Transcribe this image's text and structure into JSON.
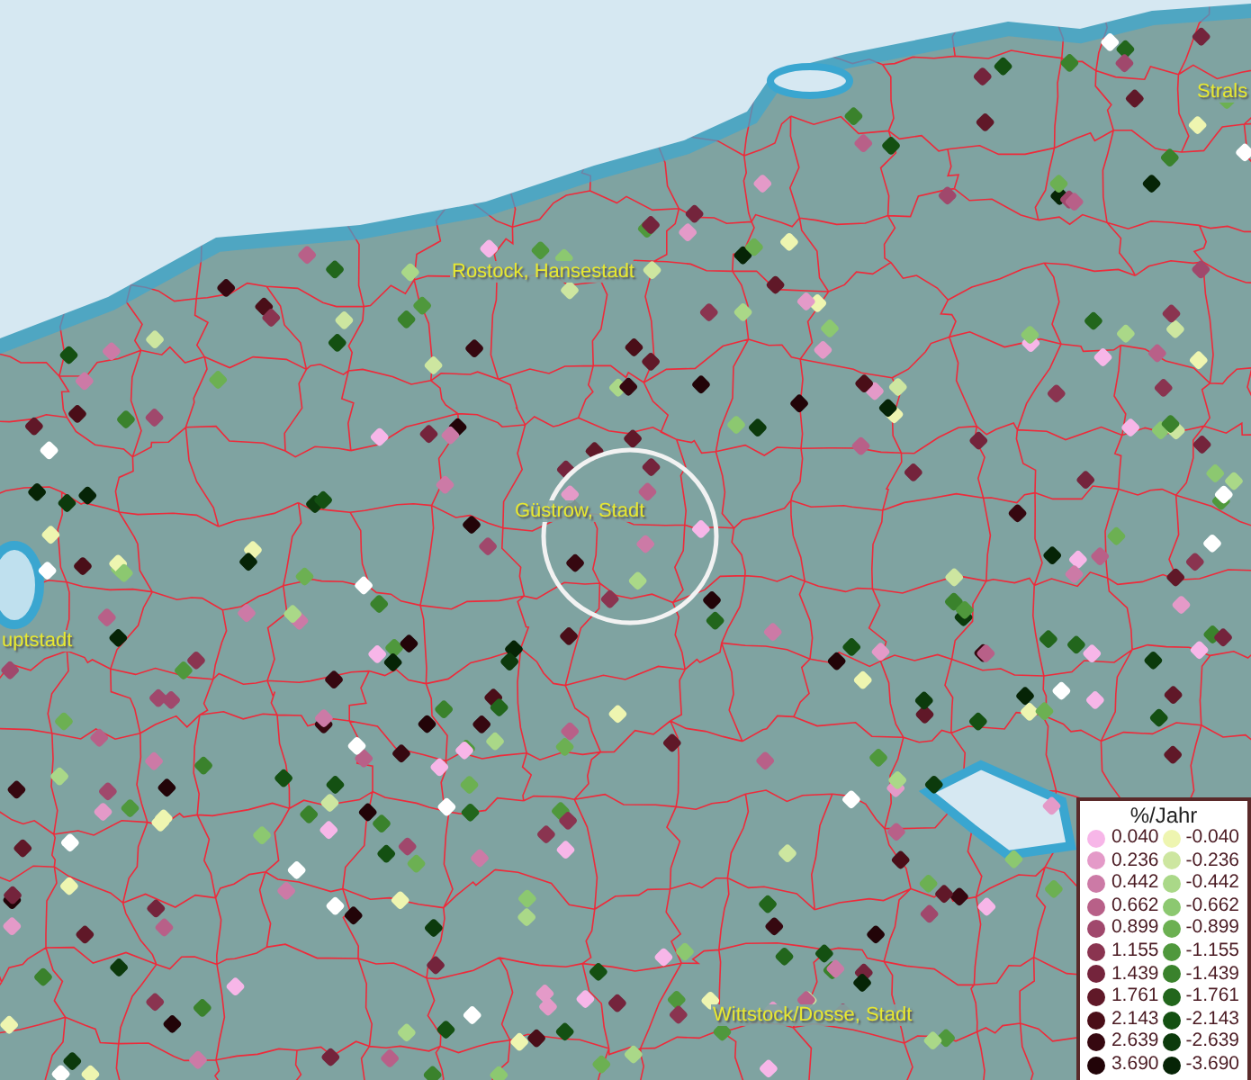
{
  "map": {
    "labels": [
      {
        "text": "Strals"
      },
      {
        "text": "Rostock, Hansestadt"
      },
      {
        "text": "Güstrow, Stadt"
      },
      {
        "text": "uptstadt"
      },
      {
        "text": "Wittstock/Dosse, Stadt"
      }
    ]
  },
  "legend": {
    "title": "%/Jahr",
    "entries": [
      {
        "label": "0.040",
        "color": "#f7b6e8"
      },
      {
        "label": "-0.040",
        "color": "#eef5b0"
      },
      {
        "label": "0.236",
        "color": "#e49ac8"
      },
      {
        "label": "-0.236",
        "color": "#cde6a0"
      },
      {
        "label": "0.442",
        "color": "#cc7aa6"
      },
      {
        "label": "-0.442",
        "color": "#aad888"
      },
      {
        "label": "0.662",
        "color": "#b86088"
      },
      {
        "label": "-0.662",
        "color": "#8cc870"
      },
      {
        "label": "0.899",
        "color": "#a0486c"
      },
      {
        "label": "-0.899",
        "color": "#6cb052"
      },
      {
        "label": "1.155",
        "color": "#8a3450"
      },
      {
        "label": "-1.155",
        "color": "#4f983c"
      },
      {
        "label": "1.439",
        "color": "#74243c"
      },
      {
        "label": "-1.439",
        "color": "#3a822c"
      },
      {
        "label": "1.761",
        "color": "#601828"
      },
      {
        "label": "-1.761",
        "color": "#22661c"
      },
      {
        "label": "2.143",
        "color": "#4a0e18"
      },
      {
        "label": "-2.143",
        "color": "#145012"
      },
      {
        "label": "2.639",
        "color": "#360810"
      },
      {
        "label": "-2.639",
        "color": "#0c3a0c"
      },
      {
        "label": "3.690",
        "color": "#220408"
      },
      {
        "label": "-3.690",
        "color": "#062406"
      }
    ]
  }
}
